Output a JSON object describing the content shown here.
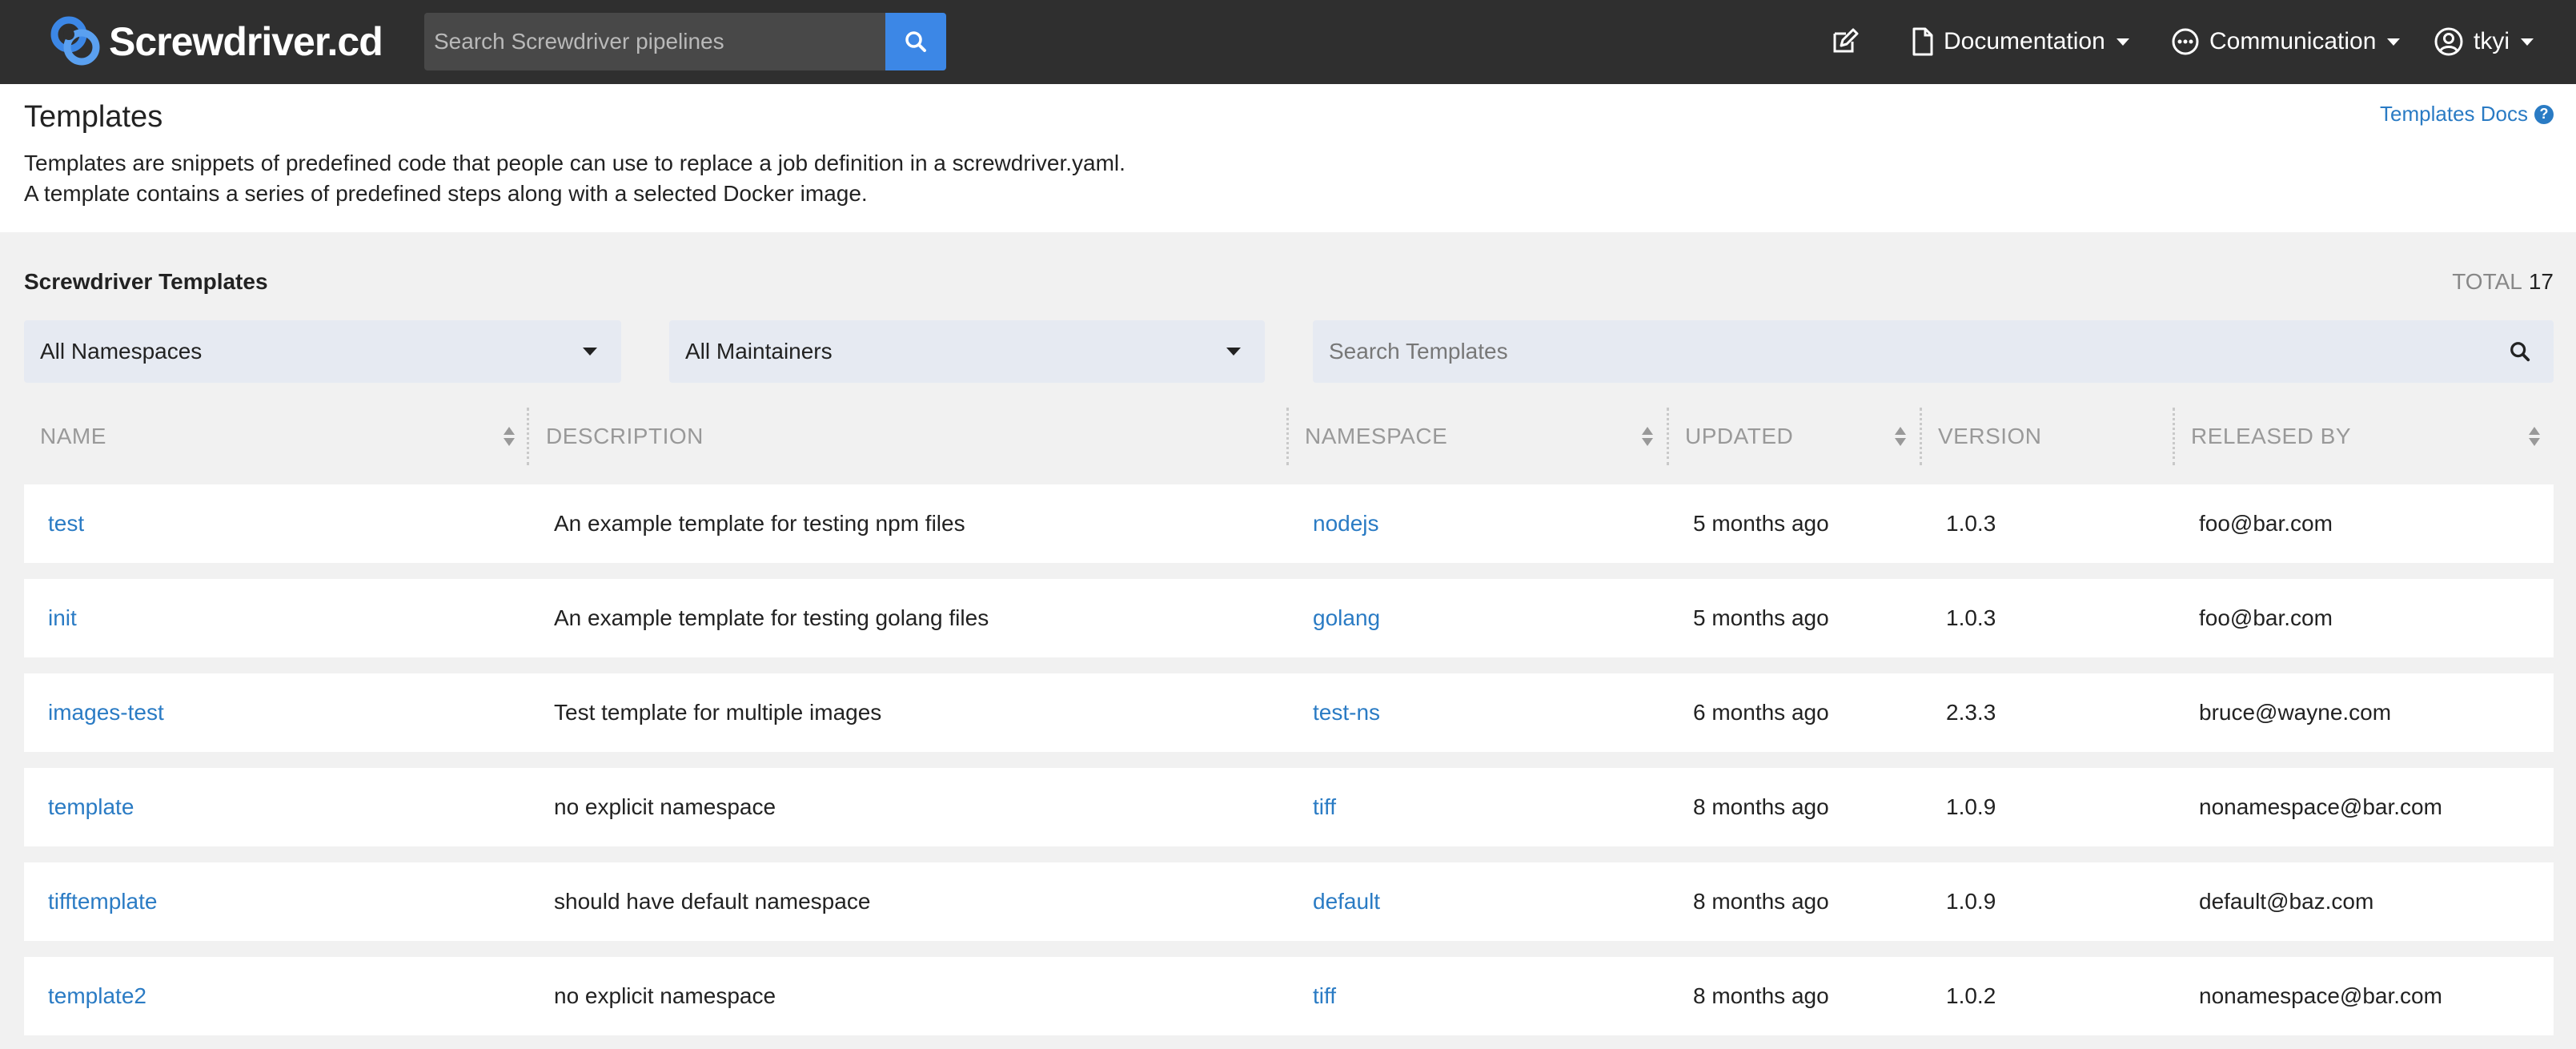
{
  "nav": {
    "brand": "Screwdriver.cd",
    "search_placeholder": "Search Screwdriver pipelines",
    "documentation": "Documentation",
    "communication": "Communication",
    "user": "tkyi"
  },
  "header": {
    "title": "Templates",
    "docs_link": "Templates Docs",
    "intro_line1": "Templates are snippets of predefined code that people can use to replace a job definition in a screwdriver.yaml.",
    "intro_line2": "A template contains a series of predefined steps along with a selected Docker image."
  },
  "templates": {
    "section_title": "Screwdriver Templates",
    "total_label": "TOTAL",
    "total_value": "17",
    "namespace_filter": "All Namespaces",
    "maintainer_filter": "All Maintainers",
    "search_placeholder": "Search Templates",
    "columns": [
      "NAME",
      "DESCRIPTION",
      "NAMESPACE",
      "UPDATED",
      "VERSION",
      "RELEASED BY"
    ],
    "rows": [
      {
        "name": "test",
        "description": "An example template for testing npm files",
        "namespace": "nodejs",
        "updated": "5 months ago",
        "version": "1.0.3",
        "released_by": "foo@bar.com"
      },
      {
        "name": "init",
        "description": "An example template for testing golang files",
        "namespace": "golang",
        "updated": "5 months ago",
        "version": "1.0.3",
        "released_by": "foo@bar.com"
      },
      {
        "name": "images-test",
        "description": "Test template for multiple images",
        "namespace": "test-ns",
        "updated": "6 months ago",
        "version": "2.3.3",
        "released_by": "bruce@wayne.com"
      },
      {
        "name": "template",
        "description": "no explicit namespace",
        "namespace": "tiff",
        "updated": "8 months ago",
        "version": "1.0.9",
        "released_by": "nonamespace@bar.com"
      },
      {
        "name": "tifftemplate",
        "description": "should have default namespace",
        "namespace": "default",
        "updated": "8 months ago",
        "version": "1.0.9",
        "released_by": "default@baz.com"
      },
      {
        "name": "template2",
        "description": "no explicit namespace",
        "namespace": "tiff",
        "updated": "8 months ago",
        "version": "1.0.2",
        "released_by": "nonamespace@bar.com"
      }
    ]
  },
  "colors": {
    "nav_bg": "#2f2f2f",
    "accent": "#3c87e6",
    "link": "#2a7bc4",
    "filter_bg": "#e6eaf2"
  }
}
